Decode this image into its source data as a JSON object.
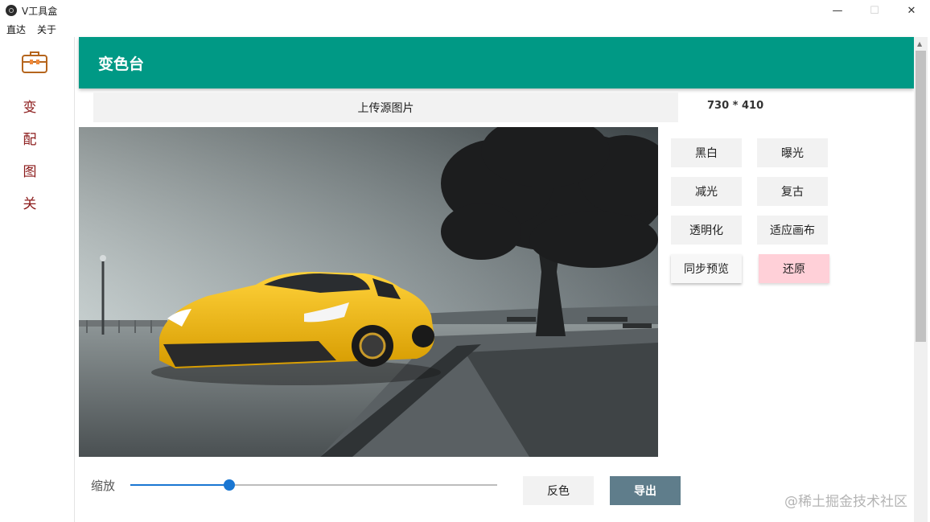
{
  "window": {
    "title": "V工具盒",
    "min_icon": "—",
    "max_icon": "☐",
    "close_icon": "✕"
  },
  "menu": [
    "直达",
    "关于"
  ],
  "sidebar": {
    "logo_icon": "toolbox-icon",
    "items": [
      "变",
      "配",
      "图",
      "关"
    ]
  },
  "header": {
    "title": "变色台"
  },
  "upload": {
    "label": "上传源图片",
    "dimensions": "730 * 410"
  },
  "tools": [
    "黑白",
    "曝光",
    "减光",
    "复古",
    "透明化",
    "适应画布",
    "同步预览",
    "还原"
  ],
  "zoom": {
    "label": "缩放",
    "value_fraction": 0.27
  },
  "actions": {
    "invert": "反色",
    "export": "导出"
  },
  "watermark": "@稀土掘金技术社区",
  "colors": {
    "header": "#009985",
    "sidebar_text": "#8b1a1a",
    "slider": "#1976d2",
    "export_button": "#5f7d8b",
    "reset_button": "#ffd0d8"
  }
}
